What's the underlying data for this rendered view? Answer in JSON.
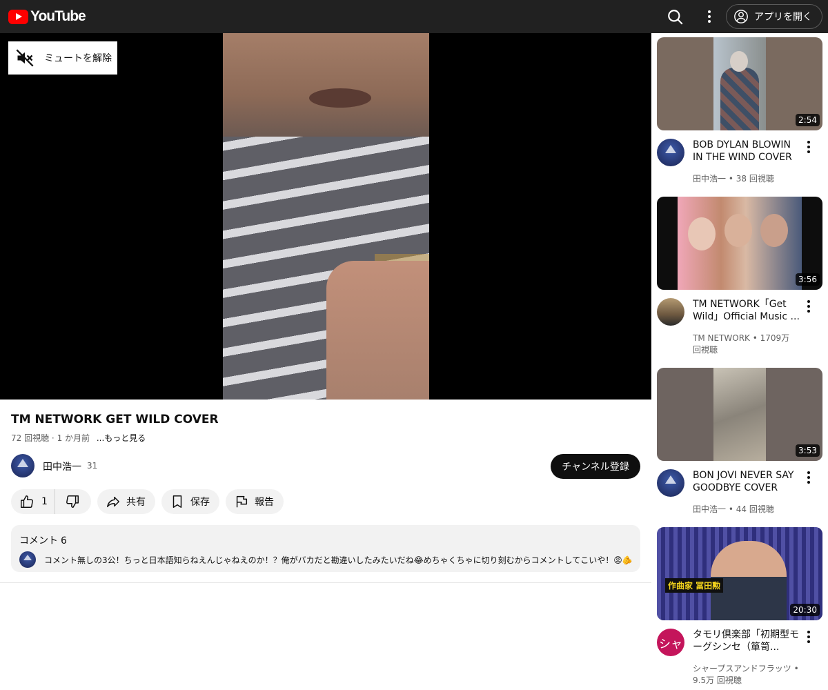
{
  "header": {
    "logo_text": "YouTube",
    "open_app_label": "アプリを開く"
  },
  "player": {
    "unmute_label": "ミュートを解除"
  },
  "video": {
    "title": "TM NETWORK GET WILD COVER",
    "views": "72 回視聴",
    "age": "1 か月前",
    "more_label": "...もっと見る"
  },
  "channel": {
    "name": "田中浩一",
    "subscribers": "31",
    "subscribe_label": "チャンネル登録"
  },
  "actions": {
    "like_count": "1",
    "share_label": "共有",
    "save_label": "保存",
    "report_label": "報告"
  },
  "comments": {
    "label": "コメント",
    "count": "6",
    "top_comment": "コメント無しの3公！ちっと日本語知らねえんじゃねえのか！？俺がバカだと勘違いしたみたいだね😂めちゃくちゃに切り刻むからコメントしてこいや！😡🫵🫵"
  },
  "recommendations": [
    {
      "title": "BOB DYLAN BLOWIN IN THE WIND COVER",
      "channel": "田中浩一",
      "views": "38 回視聴",
      "duration": "2:54"
    },
    {
      "title": "TM NETWORK「Get Wild」Official Music ...",
      "channel": "TM NETWORK",
      "views": "1709万 回視聴",
      "duration": "3:56"
    },
    {
      "title": "BON JOVI NEVER SAY GOODBYE COVER",
      "channel": "田中浩一",
      "views": "44 回視聴",
      "duration": "3:53"
    },
    {
      "title": "タモリ倶楽部「初期型モーグシンセ（箪笥...",
      "channel": "シャープスアンドフラッツ",
      "views": "9.5万 回視聴",
      "duration": "20:30",
      "avatar_text": "シャ",
      "thumb_caption": "作曲家 冨田勲"
    }
  ],
  "colors": {
    "header_bg": "#212121",
    "brand_red": "#ff0000",
    "pill_bg": "#f2f2f2",
    "subscribe_bg": "#0f0f0f"
  },
  "icons": [
    "search-icon",
    "more-vert-icon",
    "account-icon",
    "muted-speaker-icon",
    "thumb-up-icon",
    "thumb-down-icon",
    "share-icon",
    "save-icon",
    "flag-icon"
  ]
}
